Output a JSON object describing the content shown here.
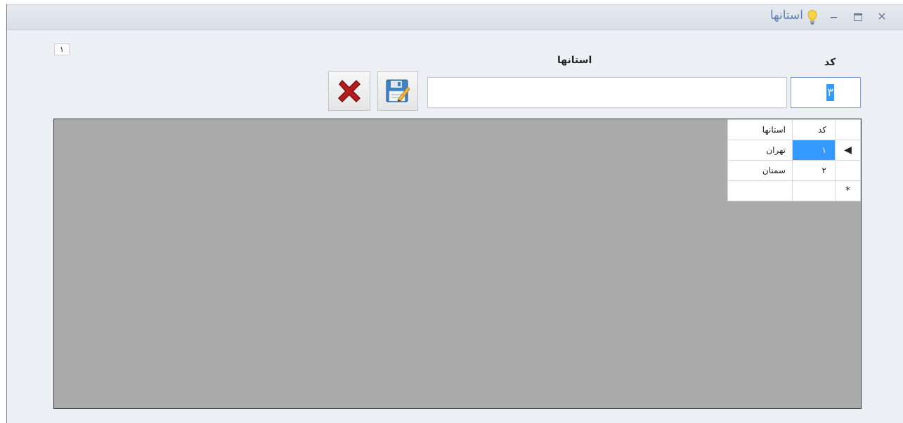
{
  "window": {
    "title": "استانها",
    "controls": {
      "minimize_icon": "minimize-icon",
      "maximize_icon": "maximize-icon",
      "close_icon": "close-icon"
    }
  },
  "badge": "١",
  "form": {
    "code_label": "کد",
    "code_value": "٣",
    "name_label": "استانها",
    "name_value": ""
  },
  "toolbar": {
    "delete_icon": "delete-x-icon",
    "save_icon": "save-edit-icon"
  },
  "grid": {
    "columns": [
      "کد",
      "استانها"
    ],
    "rows": [
      {
        "indicator": "◀",
        "code": "١",
        "name": "تهران"
      },
      {
        "indicator": "",
        "code": "٢",
        "name": "سمنان"
      },
      {
        "indicator": "*",
        "code": "",
        "name": ""
      }
    ]
  },
  "colors": {
    "selection": "#3399ff",
    "title": "#5b7fb8",
    "grid_background": "#ababab"
  }
}
